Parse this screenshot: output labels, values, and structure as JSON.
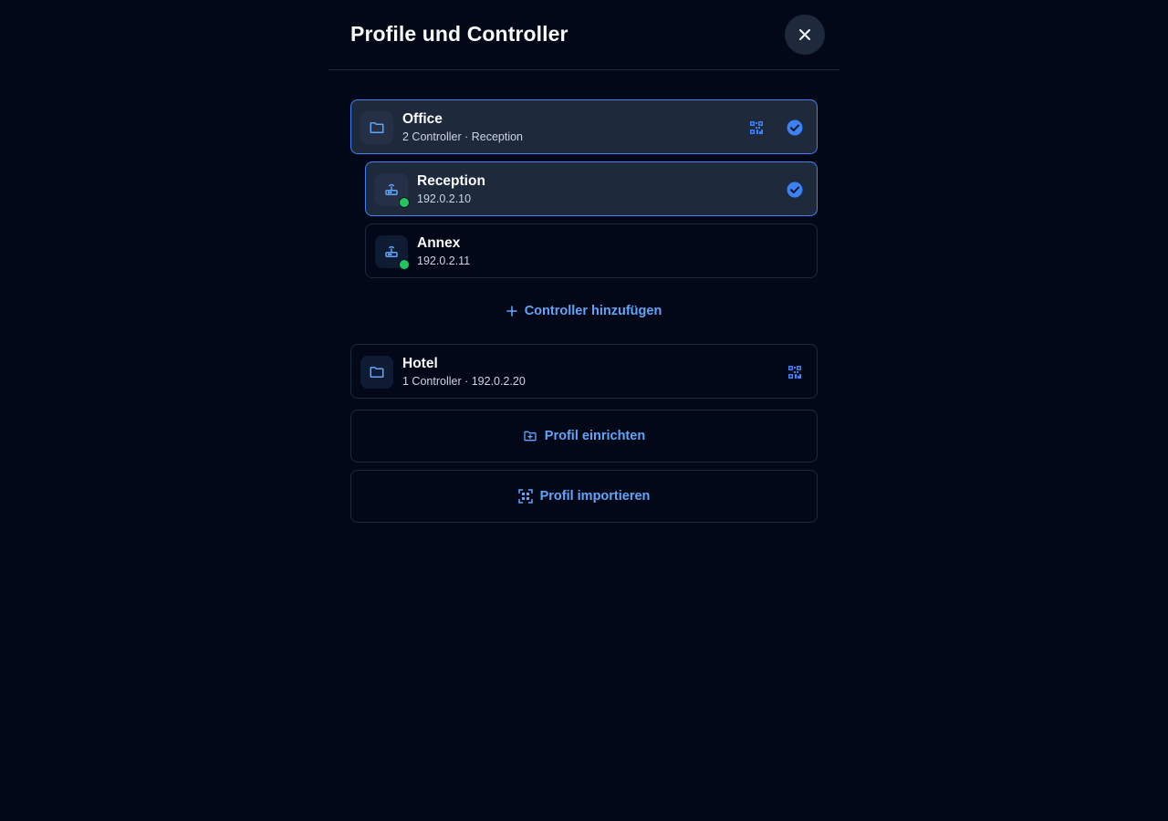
{
  "header": {
    "title": "Profile und Controller",
    "close_icon": "close-icon"
  },
  "colors": {
    "background": "#020817",
    "accent": "#3b82f6",
    "accent_text": "#60a5fa",
    "status_online": "#22c55e",
    "border": "#1e293b"
  },
  "profiles": [
    {
      "name": "Office",
      "subtitle": "2 Controller · Reception",
      "icon": "folder-icon",
      "selected": true,
      "controllers": [
        {
          "name": "Reception",
          "address": "192.0.2.10",
          "icon": "router-icon",
          "status": "online",
          "selected": true
        },
        {
          "name": "Annex",
          "address": "192.0.2.11",
          "icon": "router-icon",
          "status": "online",
          "selected": false
        }
      ],
      "add_controller_label": "Controller hinzufügen"
    },
    {
      "name": "Hotel",
      "subtitle": "1 Controller · 192.0.2.20",
      "icon": "folder-icon",
      "selected": false
    }
  ],
  "actions": {
    "create_profile_label": "Profil einrichten",
    "import_profile_label": "Profil importieren"
  }
}
